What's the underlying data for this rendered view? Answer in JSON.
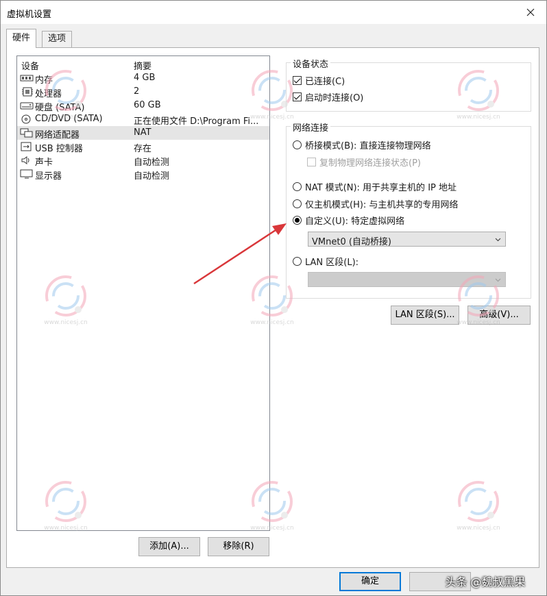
{
  "window": {
    "title": "虚拟机设置"
  },
  "tabs": [
    {
      "label": "硬件",
      "active": true
    },
    {
      "label": "选项",
      "active": false
    }
  ],
  "device_list": {
    "headers": {
      "device": "设备",
      "summary": "摘要"
    },
    "rows": [
      {
        "icon": "memory-icon",
        "name": "内存",
        "summary": "4 GB",
        "selected": false
      },
      {
        "icon": "processor-icon",
        "name": "处理器",
        "summary": "2",
        "selected": false
      },
      {
        "icon": "hard-disk-icon",
        "name": "硬盘 (SATA)",
        "summary": "60 GB",
        "selected": false
      },
      {
        "icon": "cd-dvd-icon",
        "name": "CD/DVD (SATA)",
        "summary": "正在使用文件 D:\\Program Fi...",
        "selected": false
      },
      {
        "icon": "network-adapter-icon",
        "name": "网络适配器",
        "summary": "NAT",
        "selected": true
      },
      {
        "icon": "usb-icon",
        "name": "USB 控制器",
        "summary": "存在",
        "selected": false
      },
      {
        "icon": "sound-card-icon",
        "name": "声卡",
        "summary": "自动检测",
        "selected": false
      },
      {
        "icon": "display-icon",
        "name": "显示器",
        "summary": "自动检测",
        "selected": false
      }
    ]
  },
  "list_buttons": {
    "add": "添加(A)...",
    "remove": "移除(R)"
  },
  "device_status": {
    "label": "设备状态",
    "connected": {
      "label": "已连接(C)",
      "checked": true
    },
    "connect_at_power_on": {
      "label": "启动时连接(O)",
      "checked": true
    }
  },
  "network_connection": {
    "label": "网络连接",
    "bridged": {
      "label": "桥接模式(B): 直接连接物理网络",
      "checked": false
    },
    "replicate": {
      "label": "复制物理网络连接状态(P)",
      "checked": false,
      "disabled": true
    },
    "nat": {
      "label": "NAT 模式(N): 用于共享主机的 IP 地址",
      "checked": false
    },
    "host_only": {
      "label": "仅主机模式(H): 与主机共享的专用网络",
      "checked": false
    },
    "custom": {
      "label": "自定义(U): 特定虚拟网络",
      "checked": true
    },
    "custom_select": "VMnet0 (自动桥接)",
    "lan_segment": {
      "label": "LAN 区段(L):",
      "checked": false
    },
    "lan_select": ""
  },
  "net_buttons": {
    "lan_segments": "LAN 区段(S)...",
    "advanced": "高级(V)..."
  },
  "footer_buttons": {
    "ok": "确定"
  },
  "watermark": {
    "text": "www.nicesj.cn"
  },
  "credit": "头条 @魏叔黑果",
  "colors": {
    "accent": "#0078d7",
    "arrow": "#d9373a",
    "selection": "#e5e5e5"
  }
}
